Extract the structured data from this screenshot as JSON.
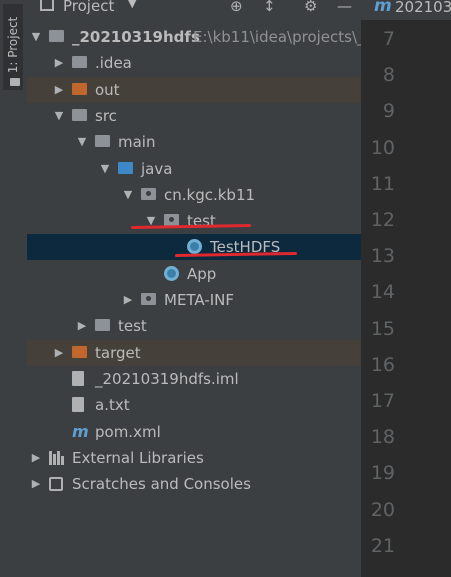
{
  "side_tab": {
    "label": "1: Project"
  },
  "toolbar": {
    "title": "Project",
    "dropdown_icon": "caret-down",
    "target_icon": "⊕",
    "collapse_icon": "↕",
    "gear_icon": "⚙",
    "minimize_icon": "—"
  },
  "tree": [
    {
      "label": "_20210319hdfs",
      "path": "E:\\kb11\\idea\\projects\\_",
      "arrow": "▼",
      "icon": "module",
      "level": 0
    },
    {
      "label": ".idea",
      "arrow": "▶",
      "icon": "folder-grey",
      "level": 1
    },
    {
      "label": "out",
      "arrow": "▶",
      "icon": "folder-orange",
      "level": 1,
      "highlight": true
    },
    {
      "label": "src",
      "arrow": "▼",
      "icon": "folder-grey",
      "level": 1
    },
    {
      "label": "main",
      "arrow": "▼",
      "icon": "folder-grey",
      "level": 2
    },
    {
      "label": "java",
      "arrow": "▼",
      "icon": "folder-blue",
      "level": 3
    },
    {
      "label": "cn.kgc.kb11",
      "arrow": "▼",
      "icon": "package",
      "level": 4
    },
    {
      "label": "test",
      "arrow": "▼",
      "icon": "package",
      "level": 5
    },
    {
      "label": "TestHDFS",
      "arrow": "",
      "icon": "java-class",
      "level": 6,
      "selected": true
    },
    {
      "label": "App",
      "arrow": "",
      "icon": "java-class",
      "level": 5
    },
    {
      "label": "META-INF",
      "arrow": "▶",
      "icon": "package",
      "level": 4
    },
    {
      "label": "test",
      "arrow": "▶",
      "icon": "folder-grey",
      "level": 2
    },
    {
      "label": "target",
      "arrow": "▶",
      "icon": "folder-orange",
      "level": 1,
      "highlight": true
    },
    {
      "label": "_20210319hdfs.iml",
      "arrow": "",
      "icon": "file-doc",
      "level": 1
    },
    {
      "label": "a.txt",
      "arrow": "",
      "icon": "file-doc",
      "level": 1
    },
    {
      "label": "pom.xml",
      "arrow": "",
      "icon": "maven",
      "level": 1
    },
    {
      "label": "External Libraries",
      "arrow": "▶",
      "icon": "libraries",
      "level": 0
    },
    {
      "label": "Scratches and Consoles",
      "arrow": "▶",
      "icon": "scratches",
      "level": 0
    }
  ],
  "editor": {
    "tab_icon": "m",
    "tab_label": "202103",
    "line_numbers": [
      "7",
      "8",
      "9",
      "10",
      "11",
      "12",
      "13",
      "14",
      "15",
      "16",
      "17",
      "18",
      "19",
      "20",
      "21"
    ]
  },
  "colors": {
    "panel_bg": "#3c3f41",
    "editor_bg": "#2b2b2b",
    "selected_row": "#0d293e",
    "excluded_row": "#45403a",
    "annotation_red": "#e0282f"
  }
}
